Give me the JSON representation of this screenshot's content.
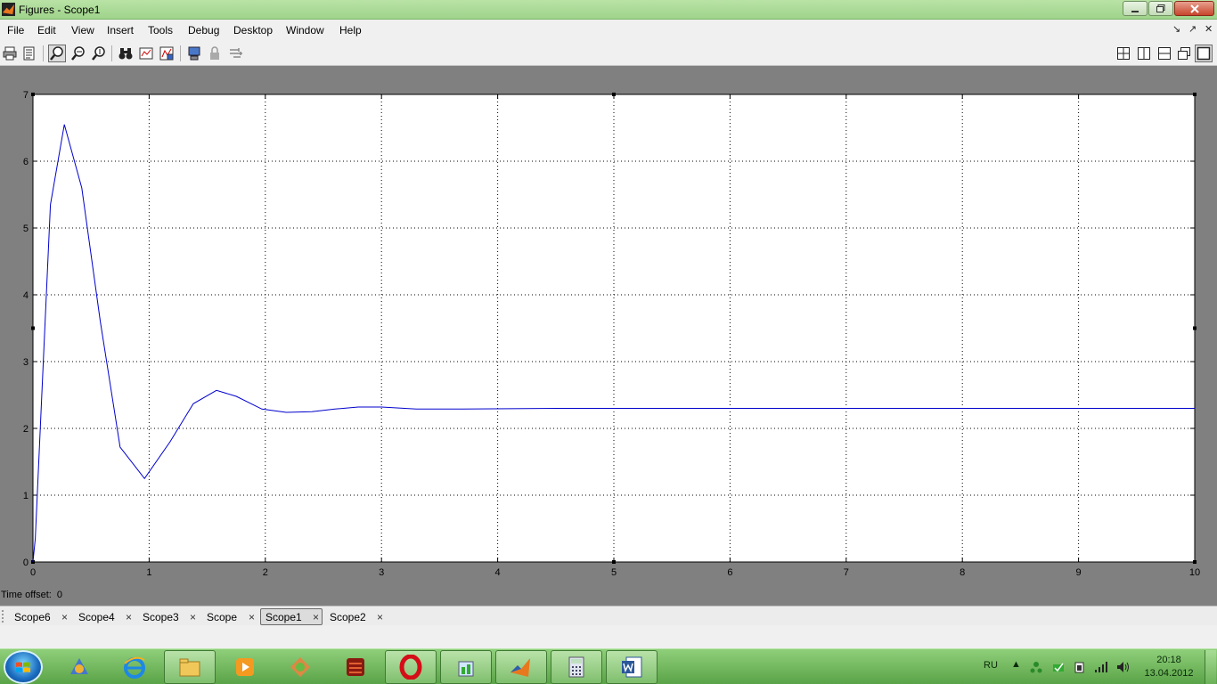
{
  "window": {
    "title": "Figures - Scope1"
  },
  "menu": [
    "File",
    "Edit",
    "View",
    "Insert",
    "Tools",
    "Debug",
    "Desktop",
    "Window",
    "Help"
  ],
  "dock_controls": [
    "↘",
    "↗",
    "✕"
  ],
  "toolbar": {
    "left": [
      "print-icon",
      "print-preview-icon",
      "zoom-in-icon",
      "zoom-x-icon",
      "zoom-y-icon",
      "binoculars-icon",
      "scope-params-icon",
      "save-axes-icon",
      "floating-scope-icon",
      "lock-icon",
      "signal-selector-icon"
    ],
    "right": [
      "tile-icon",
      "left-right-icon",
      "top-bottom-icon",
      "float-icon",
      "maximize-icon"
    ]
  },
  "time_offset": {
    "label": "Time offset:",
    "value": "0"
  },
  "tabs": [
    {
      "label": "Scope6",
      "selected": false
    },
    {
      "label": "Scope4",
      "selected": false
    },
    {
      "label": "Scope3",
      "selected": false
    },
    {
      "label": "Scope",
      "selected": false
    },
    {
      "label": "Scope1",
      "selected": true
    },
    {
      "label": "Scope2",
      "selected": false
    }
  ],
  "chart_data": {
    "type": "line",
    "xlim": [
      0,
      10
    ],
    "ylim": [
      0,
      7
    ],
    "xticks": [
      0,
      1,
      2,
      3,
      4,
      5,
      6,
      7,
      8,
      9,
      10
    ],
    "yticks": [
      0,
      1,
      2,
      3,
      4,
      5,
      6,
      7
    ],
    "grid": true,
    "series": [
      {
        "color": "#0000cc",
        "x": [
          0,
          0.02,
          0.15,
          0.27,
          0.42,
          0.58,
          0.75,
          0.96,
          1.18,
          1.38,
          1.58,
          1.75,
          1.97,
          2.18,
          2.4,
          2.6,
          2.8,
          3.0,
          3.3,
          3.7,
          4.5,
          6,
          8,
          10
        ],
        "y": [
          0,
          0.35,
          5.35,
          6.55,
          5.6,
          3.6,
          1.72,
          1.25,
          1.8,
          2.37,
          2.57,
          2.48,
          2.29,
          2.24,
          2.25,
          2.29,
          2.32,
          2.32,
          2.29,
          2.29,
          2.3,
          2.3,
          2.3,
          2.3
        ]
      }
    ]
  },
  "tray": {
    "lang": "RU",
    "time": "20:18",
    "date": "13.04.2012"
  },
  "colors": {
    "titlebar": "#9fd38b",
    "plot_line": "#0000cc",
    "figure_bg": "#808080"
  }
}
